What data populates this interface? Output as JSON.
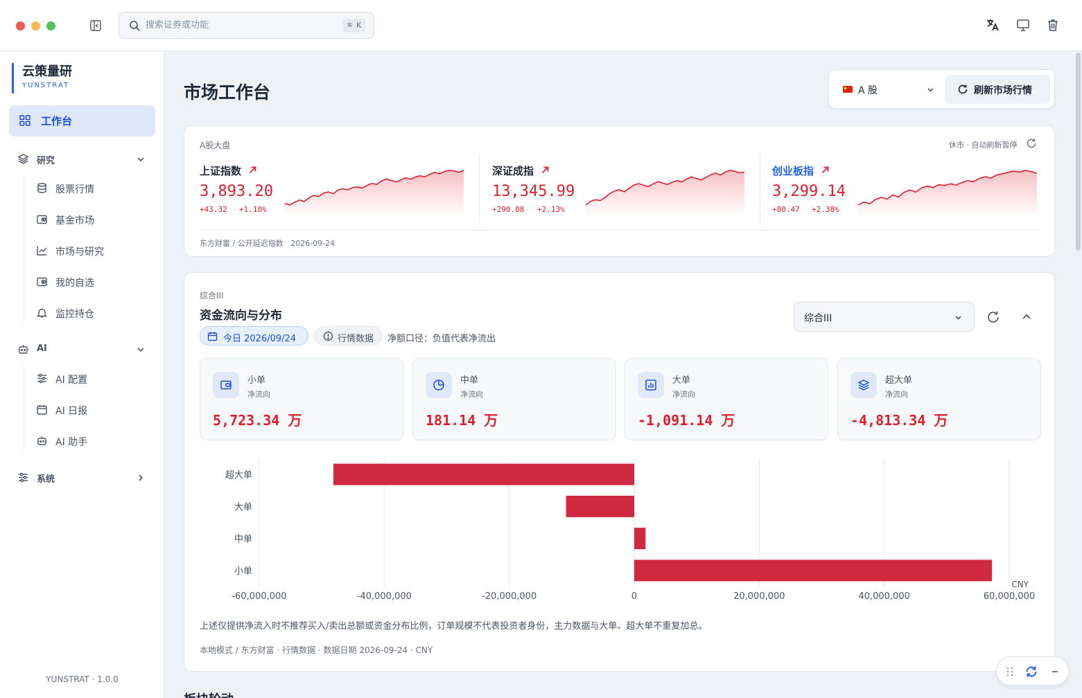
{
  "titlebar": {
    "search_placeholder": "搜索证券或功能",
    "shortcut": "⌘ K"
  },
  "sidebar": {
    "brand_title": "云策量研",
    "brand_sub": "YUNSTRAT",
    "active_item": "工作台",
    "groups": [
      {
        "label": "研究",
        "items": [
          "股票行情",
          "基金市场",
          "市场与研究",
          "我的自选",
          "监控持仓"
        ]
      },
      {
        "label": "AI",
        "items": [
          "AI 配置",
          "AI 日报",
          "AI 助手"
        ]
      },
      {
        "label": "系统",
        "items": []
      }
    ],
    "version": "YUNSTRAT · 1.0.0"
  },
  "header": {
    "page_title": "市场工作台",
    "market": "A 股",
    "refresh_label": "刷新市场行情"
  },
  "indices_card": {
    "label": "A股大盘",
    "status": "休市 · 自动刷新暂停",
    "source": "东方财富 / 公开延迟指数",
    "date": "2026-09-24",
    "indices": [
      {
        "name": "上证指数",
        "value": "3,893.20",
        "change": "+43.32",
        "pct": "+1.10%",
        "trend": [
          3851.6,
          3849.8,
          3853.1,
          3856.0,
          3854.2,
          3858.7,
          3861.9,
          3860.3,
          3864.8,
          3866.1,
          3864.0,
          3868.5,
          3870.2,
          3868.8,
          3871.6,
          3872.4,
          3870.9,
          3874.3,
          3876.8,
          3875.5,
          3879.9,
          3882.6,
          3880.4,
          3878.7,
          3881.2,
          3883.9,
          3882.1,
          3884.8,
          3886.3,
          3885.0,
          3888.4,
          3890.6,
          3889.1,
          3891.8,
          3893.2,
          3892.5,
          3890.8,
          3893.2
        ]
      },
      {
        "name": "深证成指",
        "value": "13,345.99",
        "change": "+290.08",
        "pct": "+2.13%",
        "trend": [
          13056,
          13088,
          13102,
          13095,
          13120,
          13156,
          13178,
          13190,
          13172,
          13201,
          13230,
          13244,
          13229,
          13218,
          13240,
          13262,
          13248,
          13236,
          13255,
          13270,
          13258,
          13284,
          13302,
          13290,
          13276,
          13298,
          13321,
          13336,
          13318,
          13345,
          13360,
          13352,
          13338,
          13346
        ]
      },
      {
        "name": "创业板指",
        "value": "3,299.14",
        "change": "+80.47",
        "pct": "+2.38%",
        "trend": [
          3218.7,
          3226.3,
          3221.9,
          3232.6,
          3238.1,
          3233.4,
          3244.2,
          3238.7,
          3251.3,
          3256.8,
          3251.6,
          3262.4,
          3266.9,
          3263.1,
          3270.4,
          3268.2,
          3272.8,
          3269.5,
          3276.1,
          3280.7,
          3277.9,
          3286.2,
          3290.6,
          3287.3,
          3294.8,
          3298.5,
          3301.7,
          3305.2,
          3302.4,
          3306.9,
          3303.6,
          3299.1
        ]
      }
    ]
  },
  "flow_card": {
    "label": "综合III",
    "title": "资金流向与分布",
    "date_chip": "今日 2026/09/24",
    "data_chip": "行情数据",
    "note": "净额口径：负值代表净流出",
    "select_value": "综合III",
    "summary": [
      {
        "name": "小单",
        "sub": "净流向",
        "value": "5,723.34 万",
        "icon": "wallet-icon"
      },
      {
        "name": "中单",
        "sub": "净流向",
        "value": "181.14 万",
        "icon": "pie-chart-icon"
      },
      {
        "name": "大单",
        "sub": "净流向",
        "value": "-1,091.14 万",
        "icon": "bar-chart-icon"
      },
      {
        "name": "超大单",
        "sub": "净流向",
        "value": "-4,813.34 万",
        "icon": "layers-icon"
      }
    ],
    "disclaimer": "上述仅提供净流入时不推荐买入/卖出总额或资金分布比例，订单规模不代表投资者身份，主力数据与大单、超大单不重复加总。",
    "footer": "本地模式 / 东方财富 · 行情数据 · 数据日期 2026-09-24 · CNY"
  },
  "chart_data": {
    "type": "bar",
    "orientation": "horizontal",
    "categories": [
      "超大单",
      "大单",
      "中单",
      "小单"
    ],
    "values": [
      -48133400,
      -10911400,
      1811400,
      57233400
    ],
    "xlim": [
      -60000000,
      60000000
    ],
    "xticks": [
      -60000000,
      -40000000,
      -20000000,
      0,
      20000000,
      40000000,
      60000000
    ],
    "xtick_labels": [
      "-60,000,000",
      "-40,000,000",
      "-20,000,000",
      "0",
      "20,000,000",
      "40,000,000",
      "60,000,000"
    ],
    "unit": "CNY",
    "grid": true,
    "color": "#d1293f"
  },
  "colors": {
    "accent": "#2563eb",
    "up": "#e11d2e",
    "bar": "#d1293f"
  },
  "bottom_peek": "板块轮动"
}
